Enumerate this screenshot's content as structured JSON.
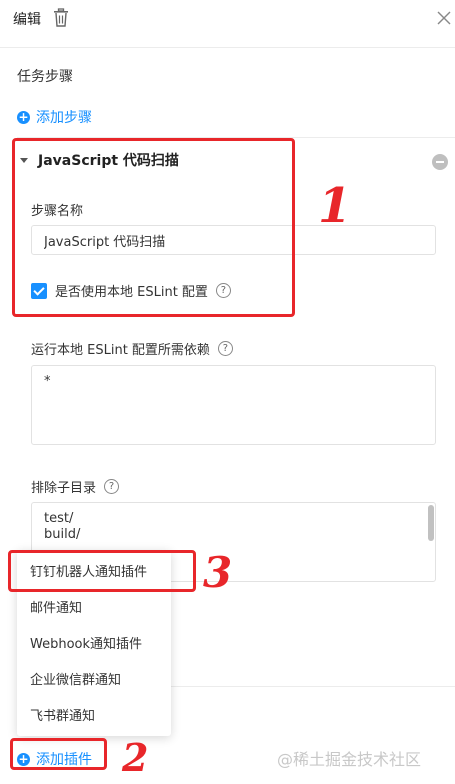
{
  "header": {
    "title": "编辑",
    "trash_icon": "trash-icon",
    "close_icon": "close-icon"
  },
  "task_steps": {
    "label": "任务步骤",
    "add_step_label": "添加步骤",
    "step": {
      "title": "JavaScript 代码扫描",
      "name_label": "步骤名称",
      "name_value": "JavaScript 代码扫描",
      "checkbox_label": "是否使用本地 ESLint 配置",
      "checkbox_checked": true,
      "deps_label": "运行本地 ESLint 配置所需依赖",
      "deps_value": "*",
      "exclude_label": "排除子目录",
      "exclude_value": "test/\nbuild/"
    }
  },
  "plugin_menu": {
    "items": [
      "钉钉机器人通知插件",
      "邮件通知",
      "Webhook通知插件",
      "企业微信群通知",
      "飞书群通知"
    ]
  },
  "add_plugin_label": "添加插件",
  "watermark": "@稀土掘金技术社区",
  "annotations": [
    "1",
    "2",
    "3"
  ],
  "colors": {
    "accent": "#1890ff",
    "annotation": "#e8262a"
  }
}
